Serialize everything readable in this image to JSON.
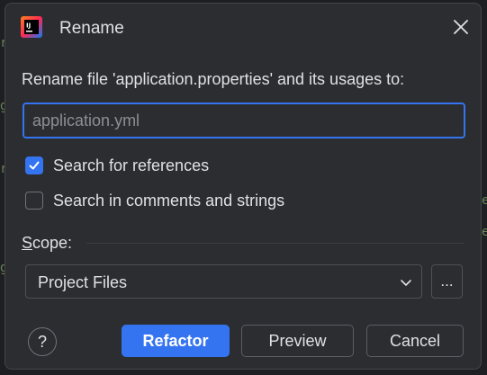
{
  "dialog": {
    "title": "Rename",
    "app_icon": "intellij-idea-icon",
    "close_icon": "close-icon"
  },
  "form": {
    "prompt": "Rename file 'application.properties' and its usages to:",
    "new_name_value": "application.yml"
  },
  "options": {
    "search_references": {
      "label": "Search for references",
      "checked": true
    },
    "search_comments": {
      "label": "Search in comments and strings",
      "checked": false
    }
  },
  "scope": {
    "label_mnemonic": "S",
    "label_rest": "cope:",
    "selected": "Project Files",
    "more_label": "..."
  },
  "footer": {
    "help_label": "?",
    "refactor_label": "Refactor",
    "preview_label": "Preview",
    "cancel_label": "Cancel"
  },
  "colors": {
    "accent": "#3574f0",
    "dialog_bg": "#2b2d30",
    "text": "#dfe1e5"
  }
}
